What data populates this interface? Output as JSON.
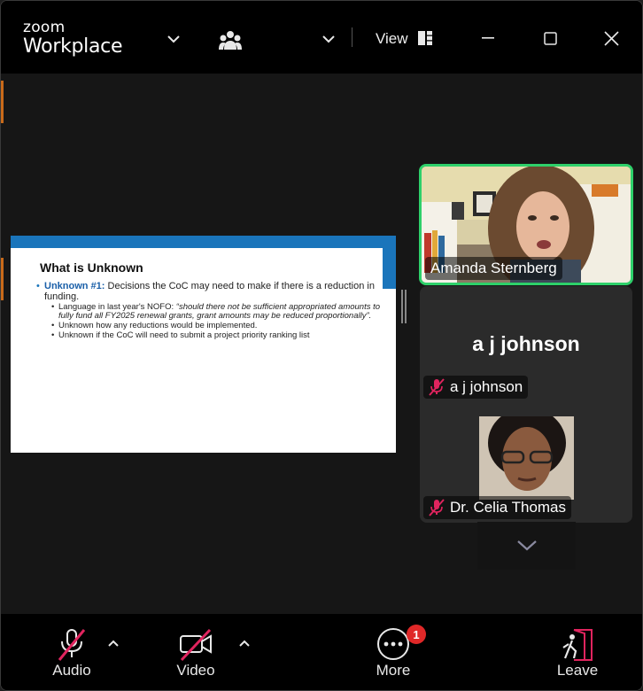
{
  "titlebar": {
    "brand_top": "zoom",
    "brand_bottom": "Workplace",
    "view_label": "View"
  },
  "slide": {
    "title": "What is Unknown",
    "bullet1_strong": "Unknown #1:",
    "bullet1_text": " Decisions the CoC may need to make if there is a reduction in funding.",
    "sub1_prefix": "Language in last year's NOFO: ",
    "sub1_quote": "“should there not be sufficient appropriated amounts to fully fund all FY2025 renewal grants, grant amounts may be reduced proportionally”.",
    "sub2": "Unknown how any reductions would be implemented.",
    "sub3": "Unknown if the CoC will need to submit a project priority ranking list"
  },
  "participants": {
    "amanda": "Amanda Sternberg",
    "aj_big": "a j johnson",
    "aj_tag": "a j johnson",
    "celia": "Dr. Celia Thomas"
  },
  "toolbar": {
    "audio": "Audio",
    "video": "Video",
    "more": "More",
    "more_badge": "1",
    "leave": "Leave"
  },
  "colors": {
    "accent_green": "#2ed06a",
    "mute_red": "#e0245e",
    "badge_red": "#e02828",
    "slide_blue": "#1a75bb"
  }
}
